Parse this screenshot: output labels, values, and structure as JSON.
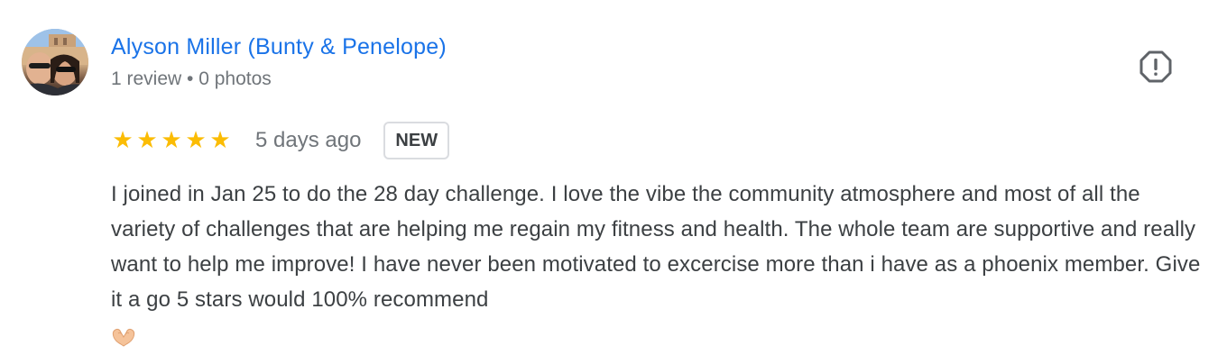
{
  "review": {
    "author": {
      "name": "Alyson Miller (Bunty & Penelope)",
      "meta": "1 review • 0 photos"
    },
    "rating": {
      "stars": 5,
      "star_glyph": "★",
      "star_color": "#fbbc04",
      "time": "5 days ago",
      "badge": "NEW"
    },
    "text": "I joined in Jan 25 to do the 28 day challenge. I love the vibe the community atmosphere and most of all the variety of challenges that are helping me regain my fitness and health. The whole team are supportive and really want to help me improve! I have never been motivated to excercise more than i have as a phoenix member. Give it a go 5 stars would 100% recommend",
    "trailing_icon": "heart-hands-icon",
    "report_icon": "report-icon"
  },
  "colors": {
    "name_link": "#1a73e8",
    "secondary_text": "#70757a",
    "body_text": "#3c4043"
  }
}
